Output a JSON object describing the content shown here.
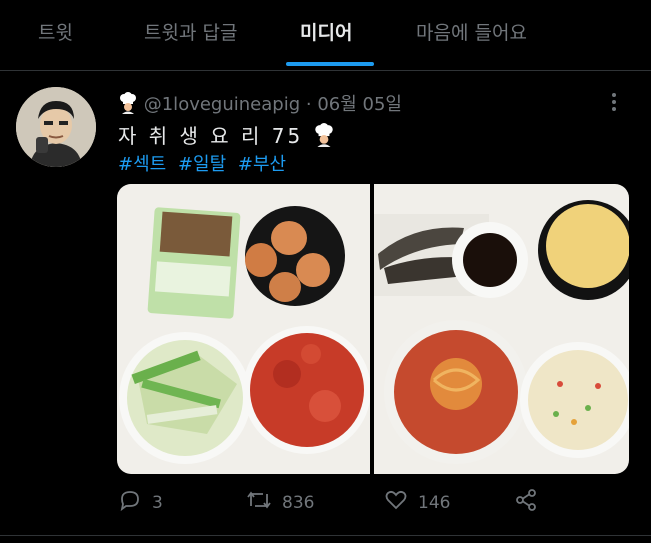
{
  "tabs": [
    {
      "label": "트윗"
    },
    {
      "label": "트윗과 답글"
    },
    {
      "label": "미디어"
    },
    {
      "label": "마음에 들어요"
    }
  ],
  "tweet": {
    "handle": "@1loveguineapig",
    "separator": "·",
    "date": "06월 05일",
    "text": "자 취 생 요 리 75",
    "hashtags": [
      "#섹트",
      "#일탈",
      "#부산"
    ],
    "media": {
      "left_image": "food-tray-ingredients",
      "right_image": "food-tray-cooked"
    },
    "actions": {
      "replies": "3",
      "retweets": "836",
      "likes": "146"
    }
  },
  "colors": {
    "accent": "#1d9bf0",
    "muted": "#71767b",
    "background": "#000000"
  }
}
